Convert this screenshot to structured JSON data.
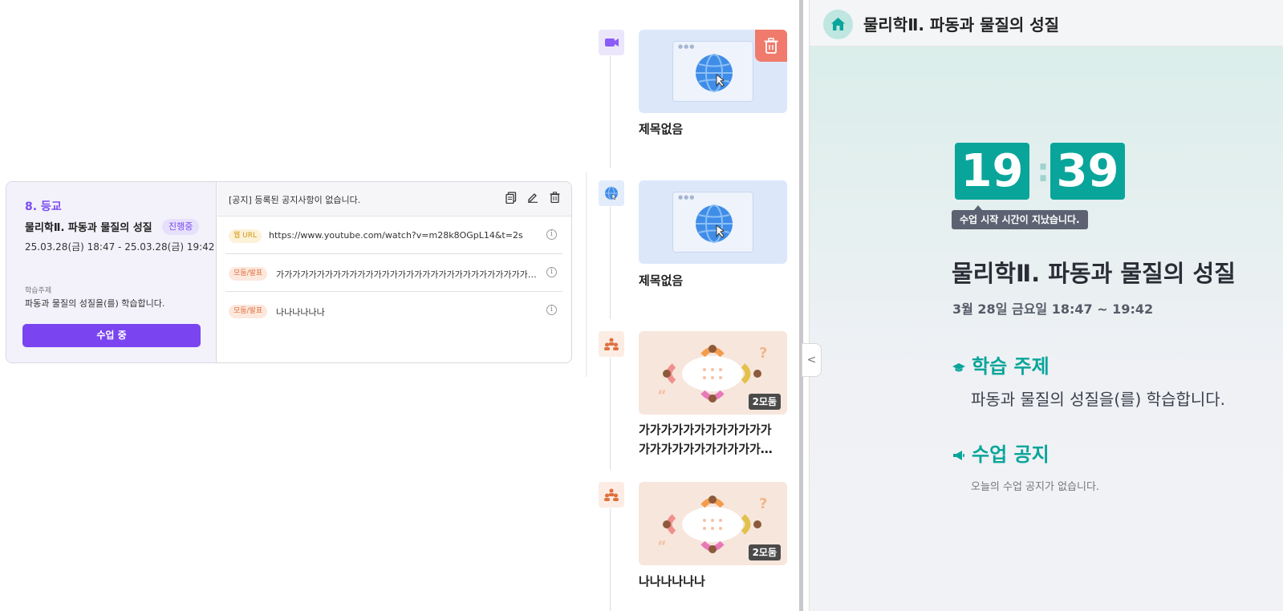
{
  "lesson": {
    "number": "8. 등교",
    "title": "물리학Ⅱ. 파동과 물질의 성질",
    "status_badge": "진행중",
    "time_range": "25.03.28(금) 18:47 - 25.03.28(금) 19:42",
    "topic_label": "학습주제",
    "topic_text": "파동과 물질의 성질을(를) 학습합니다.",
    "inclass_button": "수업 중"
  },
  "notice": {
    "text": "[공지] 등록된 공지사항이 없습니다."
  },
  "resources": [
    {
      "tag": "웹 URL",
      "text": "https://www.youtube.com/watch?v=m28k8OGpL14&t=2s"
    },
    {
      "tag": "모둠/발표",
      "text": "가가가가가가가가가가가가가가가가가가가가가가가가가가가가가가가가가가가가가가가가가가가가가가"
    },
    {
      "tag": "모둠/발표",
      "text": "나나나나나나"
    }
  ],
  "timeline": {
    "cards": [
      {
        "type": "video",
        "label": "제목없음"
      },
      {
        "type": "web",
        "label": "제목없음"
      },
      {
        "type": "group",
        "label_line1": "가가가가가가가가가가가가",
        "label_line2": "가가가가가가가가가가가…",
        "count": "2모둠"
      },
      {
        "type": "group",
        "label": "나나나나나나",
        "count": "2모둠"
      }
    ]
  },
  "right": {
    "header_title": "물리학Ⅱ. 파동과 물질의 성질",
    "clock_hour": "19",
    "clock_minute": "39",
    "clock_separator": ":",
    "clock_tip": "수업 시작 시간이 지났습니다.",
    "title": "물리학Ⅱ. 파동과 물질의 성질",
    "date_time": "3월 28일 금요일 18:47 ~ 19:42",
    "topic_heading": "학습 주제",
    "topic_body": "파동과 물질의 성질을(를) 학습합니다.",
    "notice_heading": "수업 공지",
    "notice_body": "오늘의 수업 공지가 없습니다."
  },
  "colors": {
    "accent_purple": "#7a45f0",
    "accent_teal": "#0aa59a",
    "delete_red": "#f07a6c"
  },
  "icons": [
    "video-icon",
    "globe-icon",
    "group-icon",
    "trash-icon",
    "copy-icon",
    "edit-icon",
    "info-icon",
    "home-icon",
    "graduation-cap-icon",
    "megaphone-icon",
    "chevron-left-icon"
  ]
}
